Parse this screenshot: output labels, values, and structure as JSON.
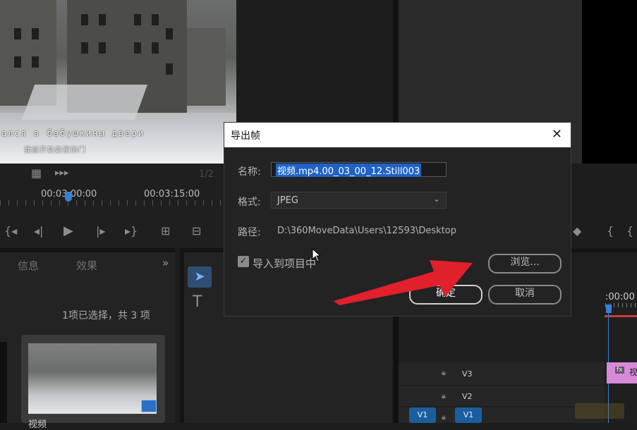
{
  "preview": {
    "subtitle_ru": "ался в бабушкины двери",
    "subtitle_cn": "我敲开奶奶家的门"
  },
  "source_monitor": {
    "timecode_current": "00:03:00:00",
    "timecode_next": "00:03:15:00",
    "zoom_label": "1/2"
  },
  "left_panel": {
    "tabs": [
      "信息",
      "效果"
    ],
    "overflow_icon": "double-chevron-right-icon",
    "selection_status": "1项已选择，共 3 项",
    "clip_label": "视频"
  },
  "dialog": {
    "title": "导出帧",
    "close_icon": "close-icon",
    "name_label": "名称:",
    "name_value": "视频.mp4.00_03_00_12.Still003",
    "format_label": "格式:",
    "format_value": "JPEG",
    "path_label": "路径:",
    "path_value": "D:\\360MoveData\\Users\\12593\\Desktop",
    "import_label": "导入到项目中",
    "import_checked": true,
    "browse_label": "浏览...",
    "ok_label": "确定",
    "cancel_label": "取消"
  },
  "timeline": {
    "timecode": ":00:00",
    "tracks": [
      "V3",
      "V2",
      "V1"
    ],
    "source_patch": "V1",
    "clip_fx": "fx",
    "clip_label": "视"
  },
  "annotation": {
    "arrow_color": "#e0202a"
  }
}
